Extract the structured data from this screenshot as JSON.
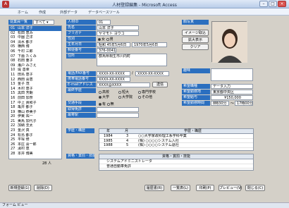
{
  "window": {
    "title": "人材登録編集 - Microsoft Access"
  },
  "ribbon": [
    "ホーム",
    "作成",
    "外部データ",
    "データベースツール"
  ],
  "list": {
    "header": "従業員一覧",
    "filter": "すべて",
    "items": [
      {
        "id": "01",
        "name": "山本 洋子"
      },
      {
        "id": "02",
        "name": "松田 恵み"
      },
      {
        "id": "03",
        "name": "中園 正洋"
      },
      {
        "id": "04",
        "name": "清水 都子"
      },
      {
        "id": "05",
        "name": "横西 博"
      },
      {
        "id": "06",
        "name": "千村 三郎"
      },
      {
        "id": "07",
        "name": "下薗 たくみ"
      },
      {
        "id": "08",
        "name": "石田 亜子"
      },
      {
        "id": "09",
        "name": "瀬戸 みさえ"
      },
      {
        "id": "10",
        "name": "堤 善幸"
      },
      {
        "id": "11",
        "name": "田島 恵子"
      },
      {
        "id": "12",
        "name": "西田 喜恵"
      },
      {
        "id": "13",
        "name": "金子 茂"
      },
      {
        "id": "14",
        "name": "木村 恵子"
      },
      {
        "id": "15",
        "name": "黒田 芳朗"
      },
      {
        "id": "16",
        "name": "前田 加奈"
      },
      {
        "id": "17",
        "name": "中上 貴和子"
      },
      {
        "id": "18",
        "name": "亀井 都子"
      },
      {
        "id": "19",
        "name": "横山 恭美子"
      },
      {
        "id": "20",
        "name": "伊東 祐一"
      },
      {
        "id": "21",
        "name": "美馬 加代子"
      },
      {
        "id": "22",
        "name": "加納 圭太"
      },
      {
        "id": "23",
        "name": "金沢 真"
      },
      {
        "id": "24",
        "name": "松島 都子"
      },
      {
        "id": "25",
        "name": "平塚 修"
      },
      {
        "id": "26",
        "name": "本庄 喜一郎"
      },
      {
        "id": "27",
        "name": "湯村 恵"
      },
      {
        "id": "28",
        "name": "本井 博美"
      }
    ],
    "count": "28 人"
  },
  "form": {
    "labels": {
      "id": "人材ID",
      "name": "氏名",
      "kana": "フリガナ",
      "gender": "性別",
      "birth": "生年月日",
      "zip": "郵便番号",
      "address": "住所",
      "phone": "電話/FAX番号",
      "mobile": "携帯電話番号",
      "email": "E-mailアドレス",
      "edu": "最終学歴",
      "license": "取得免許",
      "transport": "交通手段",
      "traffic_station": "最寄駅",
      "school": "学歴",
      "photo": "顔写真",
      "memo": "趣味",
      "hope_job": "希望職種",
      "hope_place": "希望勤務地",
      "hope_salary": "希望給与",
      "hope_time": "希望勤務時間",
      "history": "学歴・職歴",
      "qual": "資格・賞罰・技能"
    },
    "values": {
      "id": "01",
      "name": "山本 洋子",
      "kana": "ヤマモト ヨウコ",
      "gender_f": "女",
      "gender_m": "男",
      "birth": "昭和 45年5月6日",
      "birth_w": "1970年5月6日",
      "zip": "376-0041",
      "address": "群馬県桐生市川内町",
      "phone": "XXXX-XX-XXXX",
      "fax": "XXXX-XX-XXXX",
      "mobile": "XXXX-XX-XXXX",
      "email": "XXXX@XXXX",
      "edu_opts": [
        "高校",
        "短大",
        "専門学校",
        "大学",
        "大学院",
        "その他"
      ],
      "drive_yes": "有",
      "drive_no": "無",
      "hope_job": "データ入力",
      "hope_place": "東京都中央区",
      "hope_salary": "¥150,000",
      "hope_time_from": "8時30分",
      "hope_time_to": "17時00分"
    },
    "send_button": "送信"
  },
  "photo_buttons": [
    "イメージ取込",
    "拡大表示",
    "クリア"
  ],
  "history": {
    "headers": [
      "年",
      "月",
      "学歴・職歴"
    ],
    "rows": [
      {
        "year": "1984",
        "month": "3",
        "text": "○○大学家政科理工系学科卒業"
      },
      {
        "year": "1985",
        "month": "4",
        "text": "(株) ○○○○システム入社"
      },
      {
        "year": "1988",
        "month": "5",
        "text": "(株) ○○○○システム退社"
      }
    ]
  },
  "qualifications": {
    "header": "資格・賞罰・技能",
    "rows": [
      "システムアドミニストレータ",
      "普通自動車免許"
    ]
  },
  "footer_buttons": {
    "new": "新規登録(1)",
    "delete": "削除(D)",
    "print_preview": "履歴書(R)",
    "list": "一覧表(L)",
    "print": "印刷(P)",
    "preview": "プレビュー(V)",
    "close": "閉じる(C)"
  },
  "status": "フォーム ビュー"
}
